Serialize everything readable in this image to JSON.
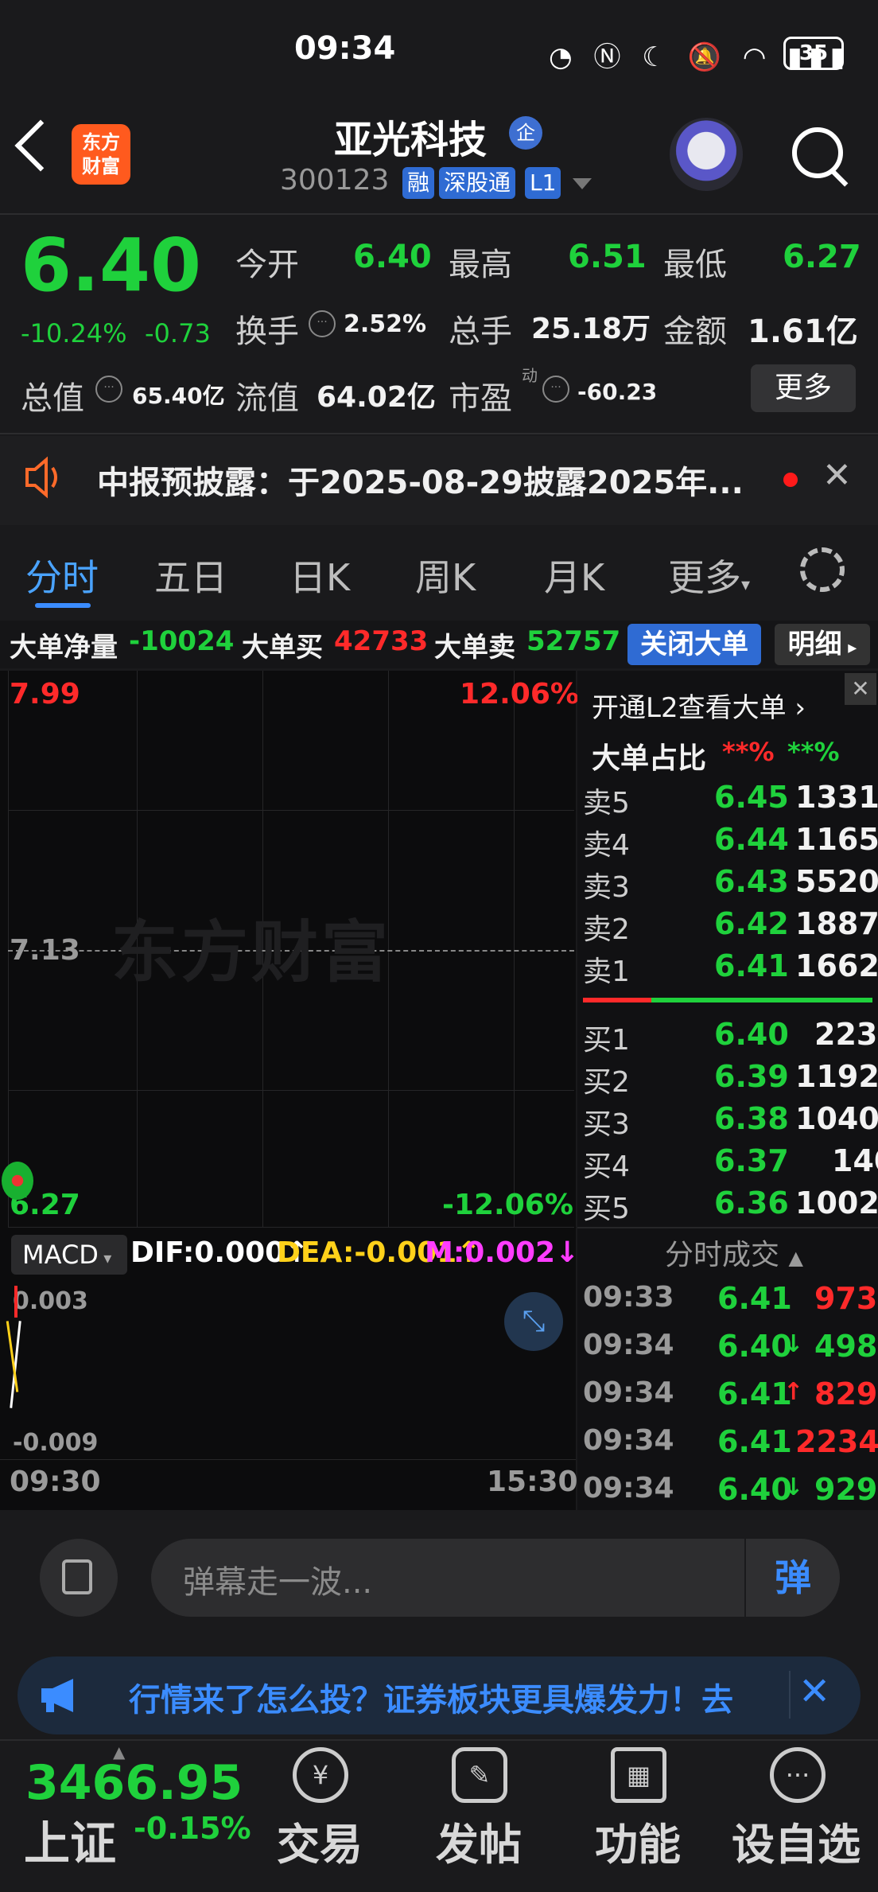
{
  "status_bar": {
    "time": "09:34",
    "battery": "35"
  },
  "header": {
    "logo": "东方\n财富",
    "stock_name": "亚光科技",
    "badge_qi": "企",
    "stock_code": "300123",
    "tags": [
      "融",
      "深股通",
      "L1"
    ]
  },
  "quote": {
    "price": "6.40",
    "change_pct": "-10.24%",
    "change": "-0.73",
    "fields": {
      "open_label": "今开",
      "open": "6.40",
      "high_label": "最高",
      "high": "6.51",
      "low_label": "最低",
      "low": "6.27",
      "turnover_label": "换手",
      "turnover": "2.52%",
      "volume_label": "总手",
      "volume": "25.18万",
      "amount_label": "金额",
      "amount": "1.61亿",
      "mktcap_label": "总值",
      "mktcap": "65.40亿",
      "float_label": "流值",
      "float": "64.02亿",
      "pe_label": "市盈",
      "pe_sup": "动",
      "pe": "-60.23"
    },
    "more_button": "更多"
  },
  "notice": {
    "text": "中报预披露：于2025-08-29披露2025年..."
  },
  "tabs": {
    "items": [
      "分时",
      "五日",
      "日K",
      "周K",
      "月K",
      "更多"
    ],
    "active": 0
  },
  "big_orders": {
    "net_label": "大单净量",
    "net": "-10024",
    "buy_label": "大单买",
    "buy": "42733",
    "sell_label": "大单卖",
    "sell": "52757",
    "close_button": "关闭大单",
    "detail_button": "明细"
  },
  "chart": {
    "watermark": "东方财富",
    "top_price": "7.99",
    "top_pct": "12.06%",
    "mid_price": "7.13",
    "bottom_price": "6.27",
    "bottom_pct": "-12.06%",
    "time_start": "09:30",
    "time_end": "15:30"
  },
  "macd": {
    "selector": "MACD",
    "dif": "DIF:0.000",
    "dea": "DEA:-0.001",
    "m": "M:0.002",
    "top": "0.003",
    "bottom": "-0.009"
  },
  "order_book": {
    "l2_link": "开通L2查看大单",
    "ratio_label": "大单占比",
    "ratio_buy": "**%",
    "ratio_sell": "**%",
    "asks": [
      {
        "label": "卖5",
        "price": "6.45",
        "vol": "1331"
      },
      {
        "label": "卖4",
        "price": "6.44",
        "vol": "1165"
      },
      {
        "label": "卖3",
        "price": "6.43",
        "vol": "5520"
      },
      {
        "label": "卖2",
        "price": "6.42",
        "vol": "1887"
      },
      {
        "label": "卖1",
        "price": "6.41",
        "vol": "1662"
      }
    ],
    "bids": [
      {
        "label": "买1",
        "price": "6.40",
        "vol": "223"
      },
      {
        "label": "买2",
        "price": "6.39",
        "vol": "1192"
      },
      {
        "label": "买3",
        "price": "6.38",
        "vol": "1040"
      },
      {
        "label": "买4",
        "price": "6.37",
        "vol": "140"
      },
      {
        "label": "买5",
        "price": "6.36",
        "vol": "1002"
      }
    ],
    "trades_label": "分时成交",
    "trades": [
      {
        "time": "09:33",
        "price": "6.41",
        "arrow": "",
        "vol": "973",
        "color": "#ff2a2a"
      },
      {
        "time": "09:34",
        "price": "6.40",
        "arrow": "↓",
        "vol": "498",
        "color": "#1fd13c"
      },
      {
        "time": "09:34",
        "price": "6.41",
        "arrow": "↑",
        "vol": "829",
        "color": "#ff2a2a"
      },
      {
        "time": "09:34",
        "price": "6.41",
        "arrow": "",
        "vol": "2234",
        "color": "#ff2a2a"
      },
      {
        "time": "09:34",
        "price": "6.40",
        "arrow": "↓",
        "vol": "929",
        "color": "#1fd13c"
      }
    ]
  },
  "danmaku": {
    "placeholder": "弹幕走一波...",
    "button": "弹"
  },
  "ad": {
    "text": "行情来了怎么投？证券板块更具爆发力！去"
  },
  "bottom_nav": {
    "index_value": "3466.95",
    "index_name": "上证",
    "index_change": "-0.15%",
    "items": [
      "交易",
      "发帖",
      "功能",
      "设自选"
    ]
  }
}
